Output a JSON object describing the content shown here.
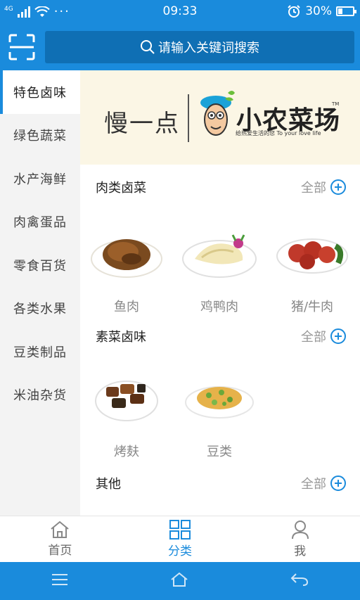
{
  "status": {
    "network": "4G",
    "dots": "···",
    "time": "09:33",
    "battery": "30%",
    "battery_level": 0.3
  },
  "search": {
    "placeholder": "请输入关键词搜索"
  },
  "sidebar": {
    "items": [
      {
        "label": "特色卤味",
        "active": true
      },
      {
        "label": "绿色蔬菜"
      },
      {
        "label": "水产海鲜"
      },
      {
        "label": "肉禽蛋品"
      },
      {
        "label": "零食百货"
      },
      {
        "label": "各类水果"
      },
      {
        "label": "豆类制品"
      },
      {
        "label": "米油杂货"
      }
    ]
  },
  "banner": {
    "slogan": "慢一点",
    "brand": "小农菜场",
    "tm": "TM",
    "tagline": "给热爱生活的您 To your love life"
  },
  "sections": [
    {
      "title": "肉类卤菜",
      "all_label": "全部",
      "items": [
        {
          "name": "鱼肉",
          "icon": "braised-fish-dish"
        },
        {
          "name": "鸡鸭肉",
          "icon": "chicken-duck-dish"
        },
        {
          "name": "猪/牛肉",
          "icon": "pork-beef-dish"
        }
      ]
    },
    {
      "title": "素菜卤味",
      "all_label": "全部",
      "items": [
        {
          "name": "烤麸",
          "icon": "kaofu-dish"
        },
        {
          "name": "豆类",
          "icon": "beans-dish"
        }
      ]
    },
    {
      "title": "其他",
      "all_label": "全部",
      "items": []
    }
  ],
  "tabs": [
    {
      "label": "首页",
      "icon": "home-icon"
    },
    {
      "label": "分类",
      "icon": "grid-icon",
      "active": true
    },
    {
      "label": "我",
      "icon": "user-icon"
    }
  ],
  "colors": {
    "primary": "#1a8bdc",
    "search_bg": "#0f6fb4",
    "banner_bg": "#fbf6e5"
  }
}
